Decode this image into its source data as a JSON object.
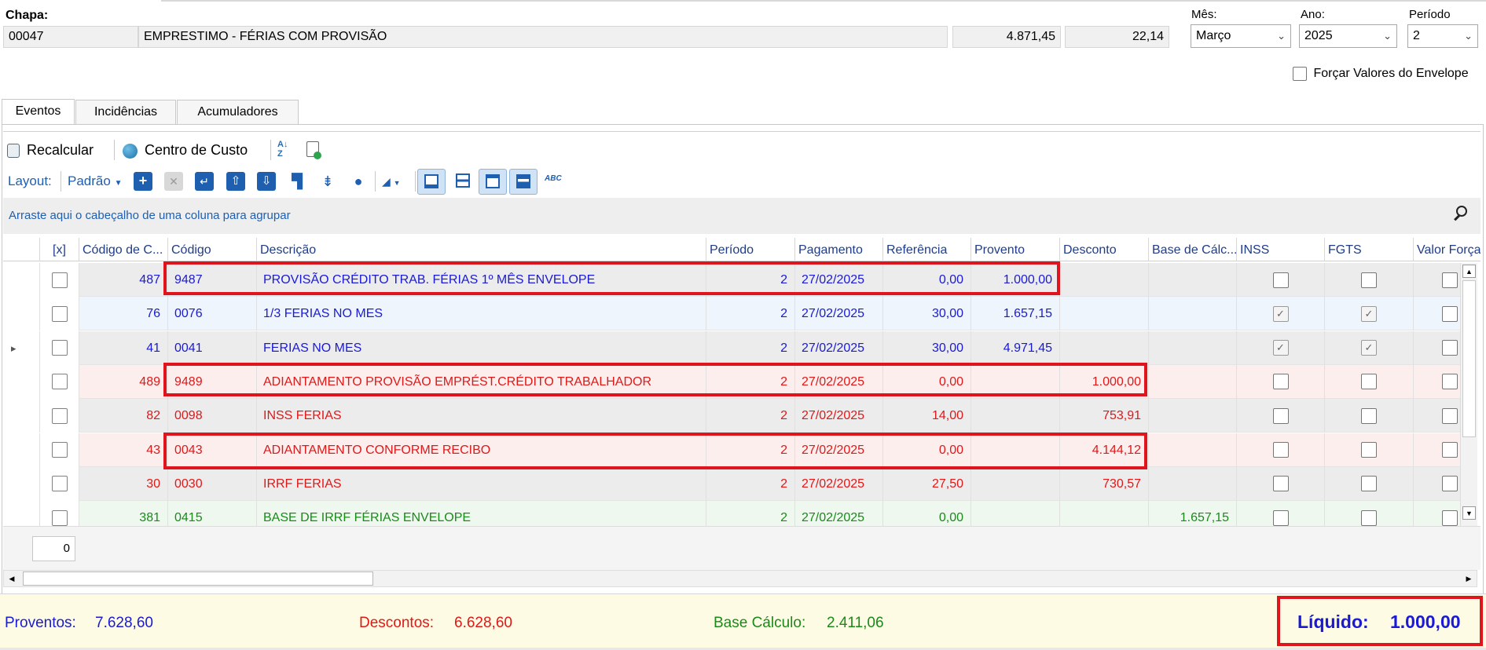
{
  "header": {
    "chapa_label": "Chapa:",
    "chapa_code": "00047",
    "chapa_desc": "EMPRESTIMO - FÉRIAS COM PROVISÃO",
    "value1": "4.871,45",
    "value2": "22,14",
    "mes_label": "Mês:",
    "mes_value": "Março",
    "ano_label": "Ano:",
    "ano_value": "2025",
    "periodo_label": "Período",
    "periodo_value": "2",
    "forcar_label": "Forçar Valores do Envelope"
  },
  "tabs": [
    "Eventos",
    "Incidências",
    "Acumuladores"
  ],
  "toolbar": {
    "recalcular": "Recalcular",
    "centro_custo": "Centro de Custo"
  },
  "layout": {
    "label": "Layout:",
    "padrao": "Padrão",
    "abc": "ABC"
  },
  "group_hint": "Arraste aqui o cabeçalho de uma coluna para agrupar",
  "columns": [
    "[x]",
    "Código de C...",
    "Código",
    "Descrição",
    "Período",
    "Pagamento",
    "Referência",
    "Provento",
    "Desconto",
    "Base de Cálc...",
    "INSS",
    "FGTS",
    "Valor Forçad"
  ],
  "rows": [
    {
      "cc": "487",
      "codigo": "9487",
      "desc": "PROVISÃO CRÉDITO TRAB. FÉRIAS 1º MÊS ENVELOPE",
      "periodo": "2",
      "pagamento": "27/02/2025",
      "referencia": "0,00",
      "provento": "1.000,00",
      "desconto": "",
      "base": "",
      "inss": false,
      "fgts": false,
      "color": "#1a1ad6"
    },
    {
      "cc": "76",
      "codigo": "0076",
      "desc": "1/3 FERIAS NO MES",
      "periodo": "2",
      "pagamento": "27/02/2025",
      "referencia": "30,00",
      "provento": "1.657,15",
      "desconto": "",
      "base": "",
      "inss": true,
      "fgts": true,
      "color": "#1a1ad6"
    },
    {
      "cc": "41",
      "codigo": "0041",
      "desc": "FERIAS NO MES",
      "periodo": "2",
      "pagamento": "27/02/2025",
      "referencia": "30,00",
      "provento": "4.971,45",
      "desconto": "",
      "base": "",
      "inss": true,
      "fgts": true,
      "color": "#1a1ad6"
    },
    {
      "cc": "489",
      "codigo": "9489",
      "desc": "ADIANTAMENTO PROVISÃO EMPRÉST.CRÉDITO TRABALHADOR",
      "periodo": "2",
      "pagamento": "27/02/2025",
      "referencia": "0,00",
      "provento": "",
      "desconto": "1.000,00",
      "base": "",
      "inss": false,
      "fgts": false,
      "color": "#e01818"
    },
    {
      "cc": "82",
      "codigo": "0098",
      "desc": "INSS FERIAS",
      "periodo": "2",
      "pagamento": "27/02/2025",
      "referencia": "14,00",
      "provento": "",
      "desconto": "753,91",
      "base": "",
      "inss": false,
      "fgts": false,
      "color": "#e01818"
    },
    {
      "cc": "43",
      "codigo": "0043",
      "desc": "ADIANTAMENTO CONFORME RECIBO",
      "periodo": "2",
      "pagamento": "27/02/2025",
      "referencia": "0,00",
      "provento": "",
      "desconto": "4.144,12",
      "base": "",
      "inss": false,
      "fgts": false,
      "color": "#e01818"
    },
    {
      "cc": "30",
      "codigo": "0030",
      "desc": "IRRF FERIAS",
      "periodo": "2",
      "pagamento": "27/02/2025",
      "referencia": "27,50",
      "provento": "",
      "desconto": "730,57",
      "base": "",
      "inss": false,
      "fgts": false,
      "color": "#e01818"
    },
    {
      "cc": "381",
      "codigo": "0415",
      "desc": "BASE DE IRRF FÉRIAS ENVELOPE",
      "periodo": "2",
      "pagamento": "27/02/2025",
      "referencia": "0,00",
      "provento": "",
      "desconto": "",
      "base": "1.657,15",
      "inss": false,
      "fgts": false,
      "color": "#1a8a1a"
    }
  ],
  "count_value": "0",
  "footer": {
    "proventos_label": "Proventos:",
    "proventos_value": "7.628,60",
    "descontos_label": "Descontos:",
    "descontos_value": "6.628,60",
    "base_label": "Base Cálculo:",
    "base_value": "2.411,06",
    "liquido_label": "Líquido:",
    "liquido_value": "1.000,00"
  },
  "colors": {
    "blue_text": "#1a1ad6",
    "red_text": "#e01818",
    "green_text": "#1a8a1a",
    "highlight": "#e0141c",
    "footer_bg": "#fdfbe4"
  }
}
